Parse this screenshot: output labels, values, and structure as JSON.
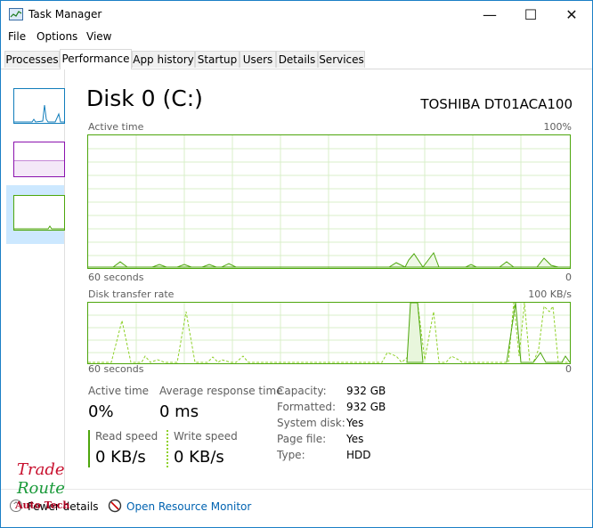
{
  "window": {
    "title": "Task Manager",
    "minimize_glyph": "—",
    "maximize_glyph": "☐",
    "close_glyph": "✕"
  },
  "menu": [
    {
      "label": "File"
    },
    {
      "label": "Options"
    },
    {
      "label": "View"
    }
  ],
  "tabs": [
    {
      "label": "Processes"
    },
    {
      "label": "Performance",
      "active": true
    },
    {
      "label": "App history"
    },
    {
      "label": "Startup"
    },
    {
      "label": "Users"
    },
    {
      "label": "Details"
    },
    {
      "label": "Services"
    }
  ],
  "disk": {
    "title": "Disk 0 (C:)",
    "model": "TOSHIBA DT01ACA100"
  },
  "active_graph": {
    "label": "Active time",
    "max_label": "100%",
    "time_label": "60 seconds",
    "min_label": "0"
  },
  "transfer_graph": {
    "label": "Disk transfer rate",
    "max_label": "100 KB/s",
    "time_label": "60 seconds",
    "min_label": "0"
  },
  "stats": {
    "active_time_label": "Active time",
    "active_time_value": "0%",
    "avg_response_label": "Average response time",
    "avg_response_value": "0 ms",
    "read_speed_label": "Read speed",
    "read_speed_value": "0 KB/s",
    "write_speed_label": "Write speed",
    "write_speed_value": "0 KB/s"
  },
  "info": [
    {
      "label": "Capacity:",
      "value": "932 GB"
    },
    {
      "label": "Formatted:",
      "value": "932 GB"
    },
    {
      "label": "System disk:",
      "value": "Yes"
    },
    {
      "label": "Page file:",
      "value": "Yes"
    },
    {
      "label": "Type:",
      "value": "HDD"
    }
  ],
  "footer": {
    "fewer_details": "Fewer details",
    "open_resource_monitor": "Open Resource Monitor"
  },
  "watermark": {
    "line1": "Trade",
    "line2": "Route",
    "line3": "Auto Tech"
  },
  "colors": {
    "accent_window": "#1b7fc6",
    "disk_green": "#4da60c",
    "write_green": "#8fd12a",
    "cpu_blue": "#117dbb",
    "memory_purple": "#8b12ae",
    "link_blue": "#0063b1"
  }
}
